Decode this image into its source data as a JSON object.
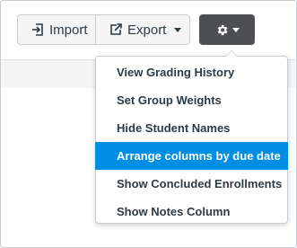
{
  "toolbar": {
    "import_label": "Import",
    "import_icon": "import-icon",
    "export_label": "Export",
    "export_icon": "export-icon",
    "settings_icon": "gear-icon"
  },
  "menu": {
    "items": [
      {
        "label": "View Grading History",
        "active": false
      },
      {
        "label": "Set Group Weights",
        "active": false
      },
      {
        "label": "Hide Student Names",
        "active": false
      },
      {
        "label": "Arrange columns by due date",
        "active": true
      },
      {
        "label": "Show Concluded Enrollments",
        "active": false
      },
      {
        "label": "Show Notes Column",
        "active": false
      }
    ]
  },
  "colors": {
    "active_item": "#008ee2",
    "settings_button": "#4d4f52",
    "text": "#2d3b45"
  }
}
